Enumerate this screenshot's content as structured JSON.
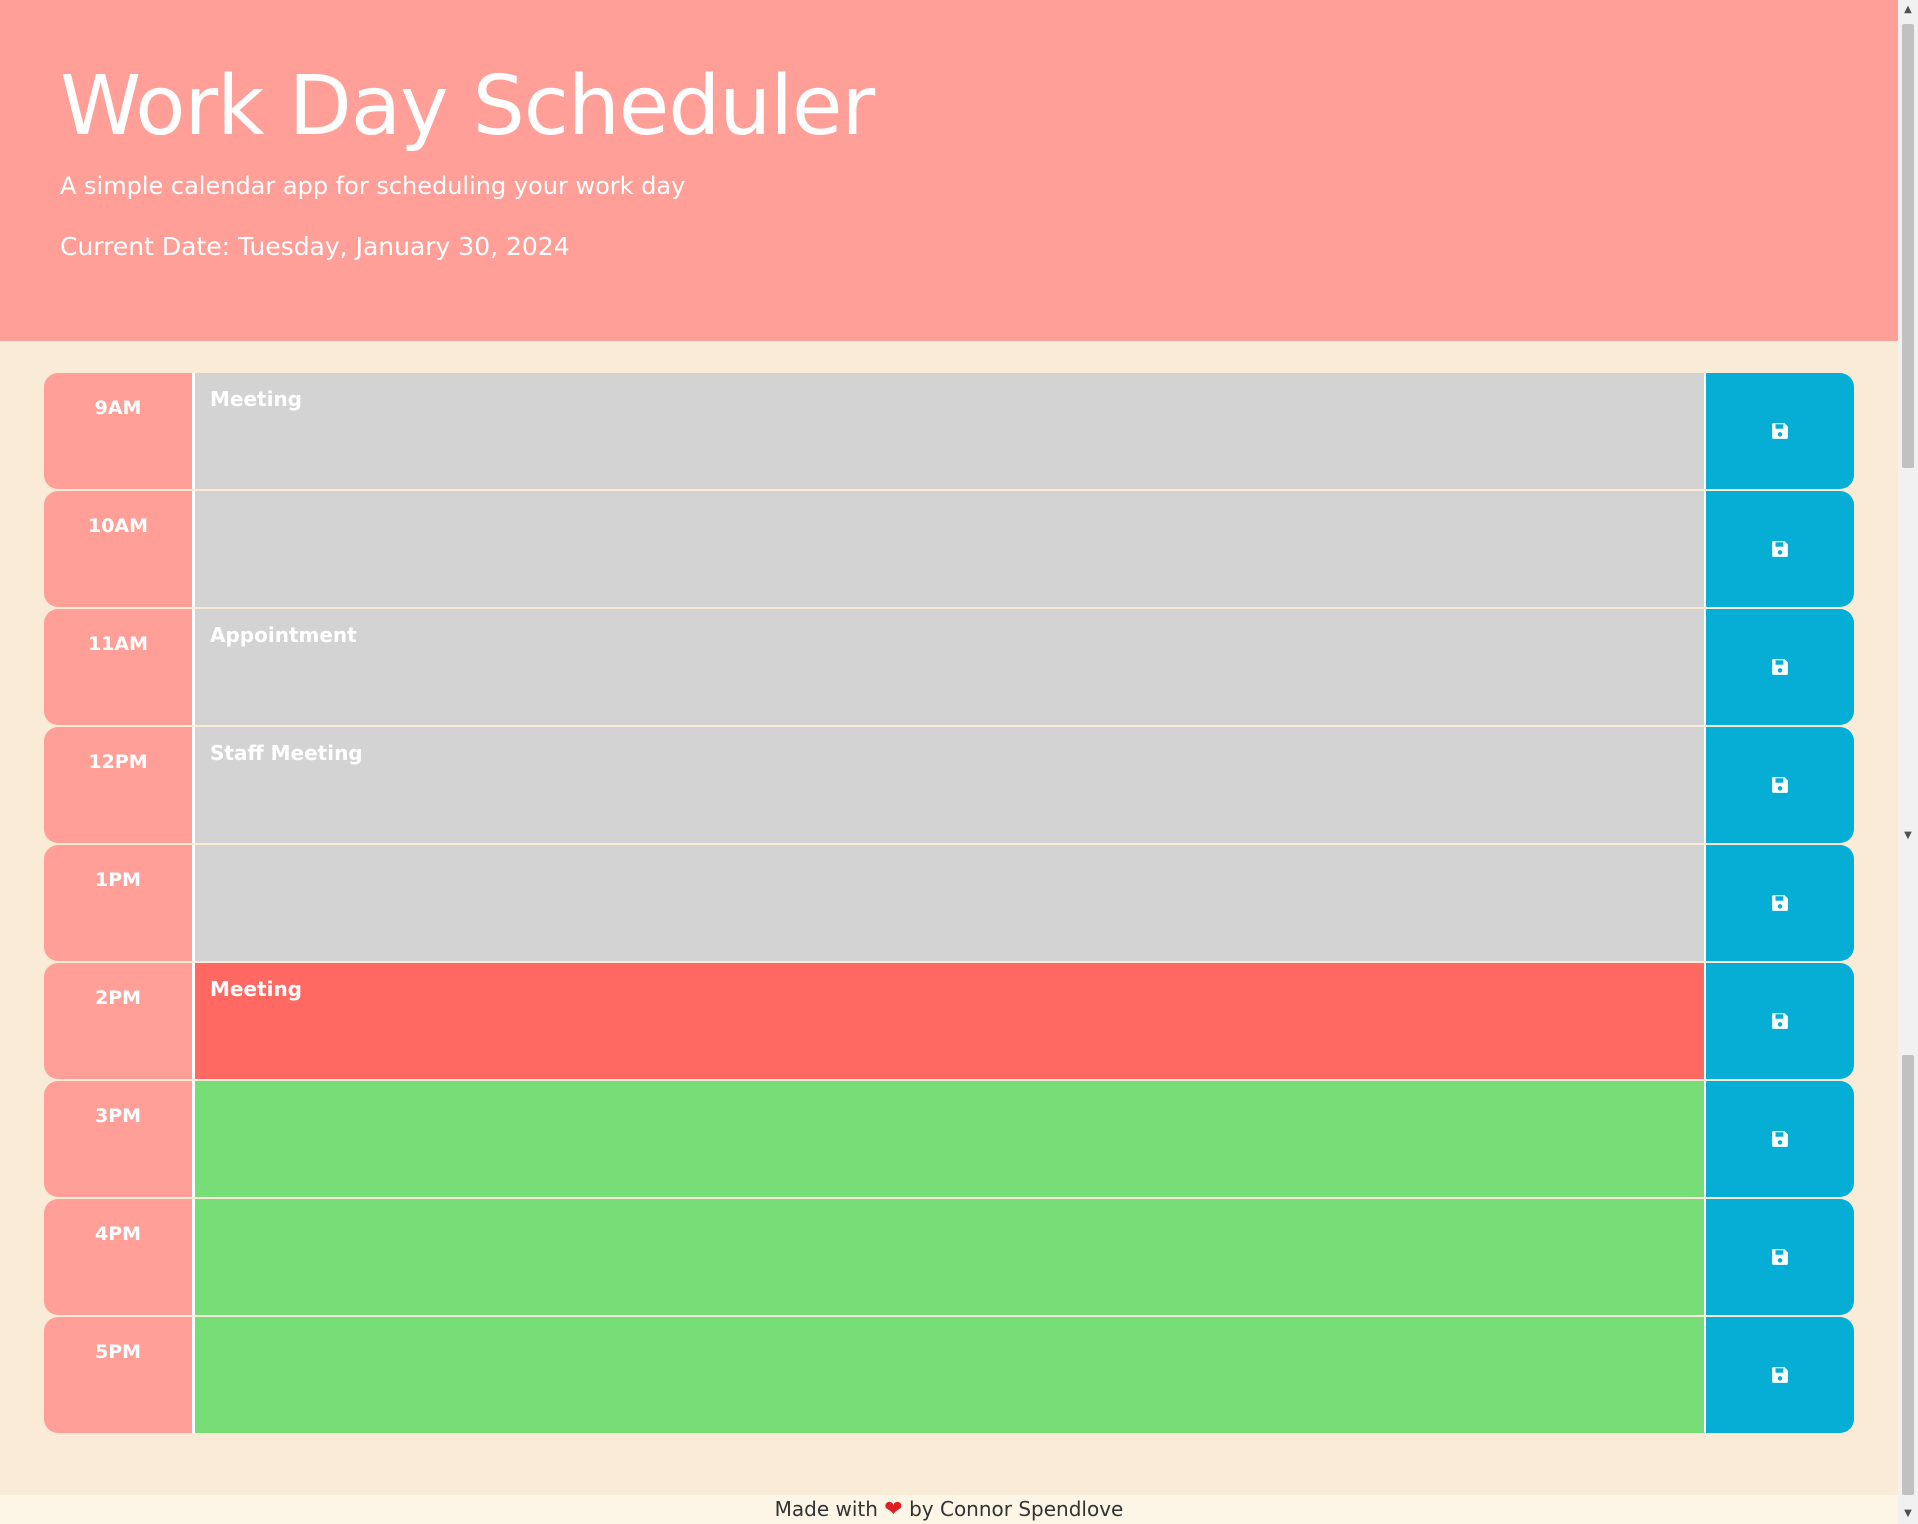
{
  "header": {
    "title": "Work Day Scheduler",
    "subtitle": "A simple calendar app for scheduling your work day",
    "current_date": "Current Date: Tuesday, January 30, 2024"
  },
  "colors": {
    "header_bg": "#ff9f97",
    "page_bg": "#faebd7",
    "past": "#d3d3d3",
    "present": "#ff6961",
    "future": "#77dd77",
    "save_button": "#06aed5"
  },
  "rows": [
    {
      "hour": "9AM",
      "text": "Meeting",
      "state": "past",
      "save_icon": "save-icon"
    },
    {
      "hour": "10AM",
      "text": "",
      "state": "past",
      "save_icon": "save-icon"
    },
    {
      "hour": "11AM",
      "text": "Appointment",
      "state": "past",
      "save_icon": "save-icon"
    },
    {
      "hour": "12PM",
      "text": "Staff Meeting",
      "state": "past",
      "save_icon": "save-icon"
    },
    {
      "hour": "1PM",
      "text": "",
      "state": "past",
      "save_icon": "save-icon"
    },
    {
      "hour": "2PM",
      "text": "Meeting",
      "state": "present",
      "save_icon": "save-icon"
    },
    {
      "hour": "3PM",
      "text": "",
      "state": "future",
      "save_icon": "save-icon"
    },
    {
      "hour": "4PM",
      "text": "",
      "state": "future",
      "save_icon": "save-icon"
    },
    {
      "hour": "5PM",
      "text": "",
      "state": "future",
      "save_icon": "save-icon"
    }
  ],
  "footer": {
    "prefix": "Made with",
    "heart": "❤",
    "suffix": "by Connor Spendlove"
  }
}
